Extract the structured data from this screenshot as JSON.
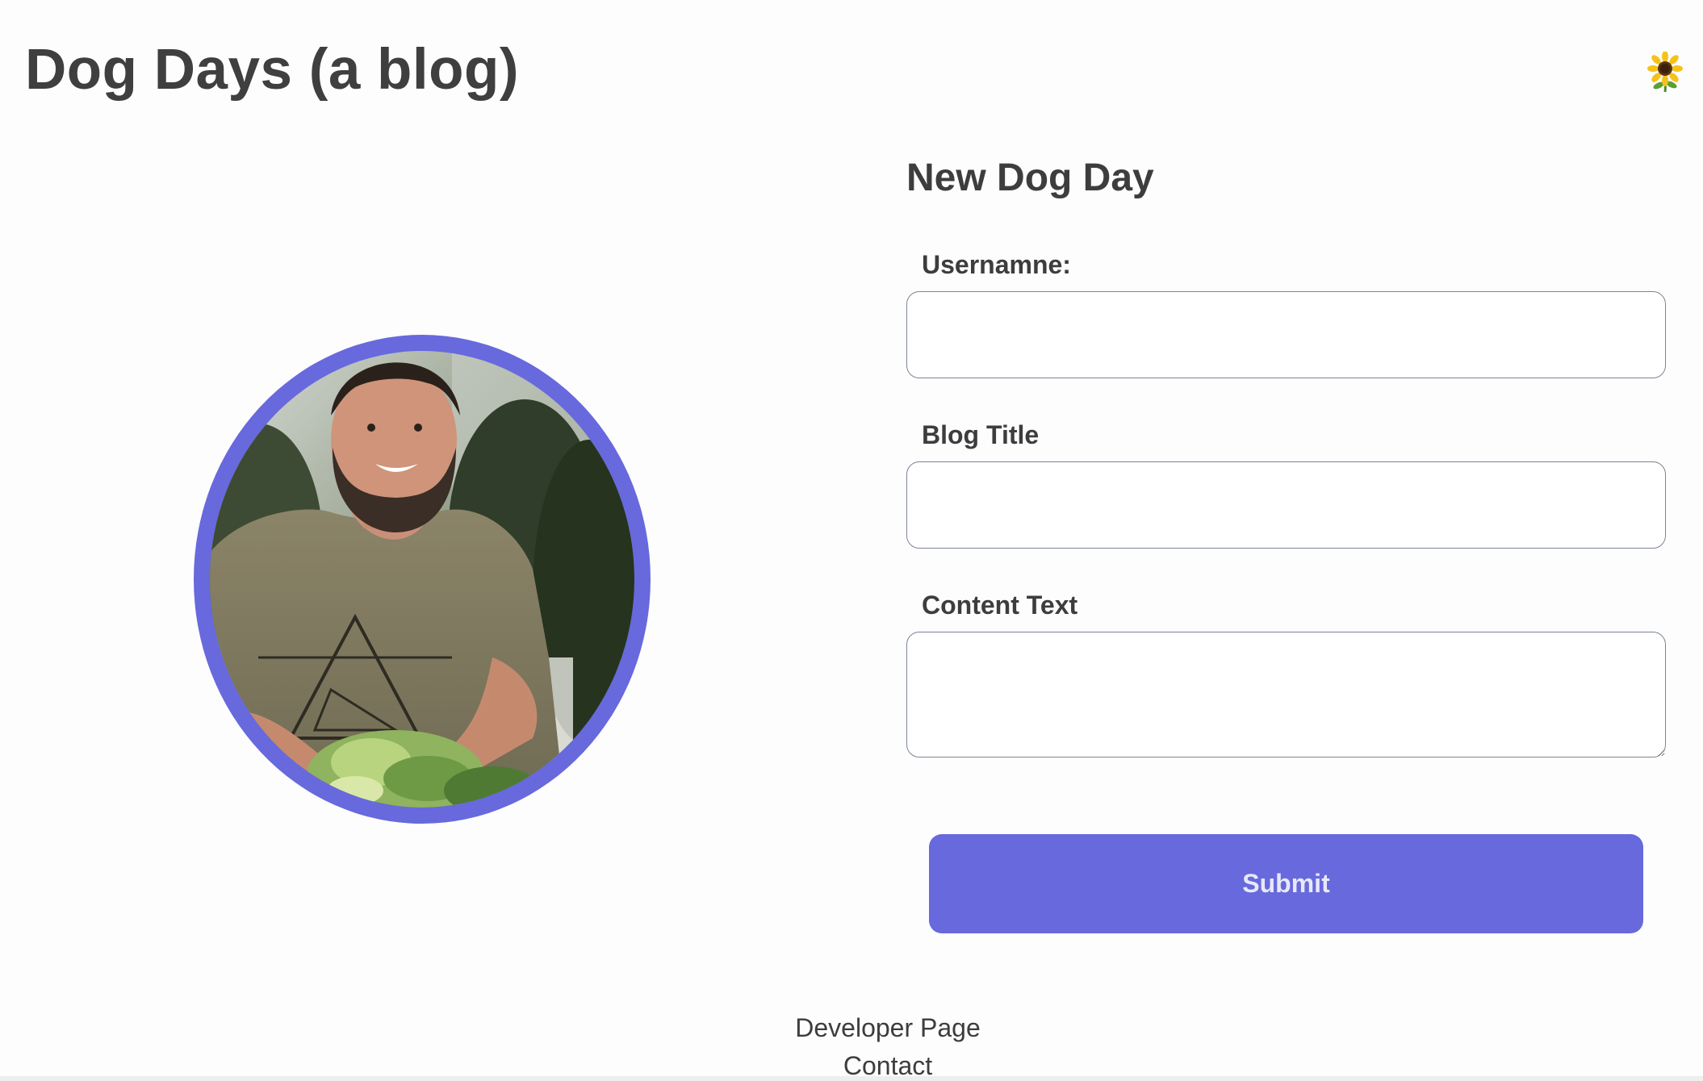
{
  "header": {
    "site_title": "Dog Days (a blog)",
    "theme_icon": "sunflower-icon"
  },
  "profile": {
    "image": "profile-photo",
    "ring_color": "#6769dd"
  },
  "form": {
    "title": "New Dog Day",
    "username_label": "Usernamne:",
    "username_value": "",
    "blog_title_label": "Blog Title",
    "blog_title_value": "",
    "content_label": "Content Text",
    "content_value": "",
    "submit_label": "Submit"
  },
  "footer": {
    "developer_link": "Developer Page",
    "contact_link": "Contact"
  },
  "colors": {
    "accent": "#6769dd",
    "text": "#3d3d3d",
    "field_border": "#7b8594"
  }
}
